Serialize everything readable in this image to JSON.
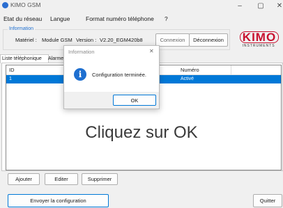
{
  "window": {
    "title": "KIMO GSM",
    "controls": {
      "minimize": "–",
      "maximize": "▢",
      "close": "✕"
    }
  },
  "menu": [
    {
      "label": "Etat du réseau"
    },
    {
      "label": "Langue"
    },
    {
      "label": "Format numéro téléphone"
    },
    {
      "label": "?"
    }
  ],
  "information": {
    "group_title": "Information",
    "materiel_label": "Matériel :",
    "materiel_value": "Module GSM",
    "version_label": "Version :",
    "version_value": "V2.20_EGM420b8",
    "connexion_label": "Connexion",
    "deconnexion_label": "Déconnexion"
  },
  "logo": {
    "name": "KIMO",
    "tagline": "INSTRUMENTS",
    "color": "#c8102e"
  },
  "tabs": [
    {
      "label": "Liste téléphonique",
      "active": true
    },
    {
      "label": "Alarme",
      "active": false
    }
  ],
  "table": {
    "columns": [
      "ID",
      "Numéro"
    ],
    "rows": [
      {
        "id": "1",
        "numero": "Activé",
        "selected": true
      }
    ]
  },
  "list_buttons": {
    "ajouter": "Ajouter",
    "editer": "Editer",
    "supprimer": "Supprimer"
  },
  "footer": {
    "send_config": "Envoyer la configuration",
    "quit": "Quitter"
  },
  "dialog": {
    "title": "Information",
    "close": "✕",
    "message": "Configuration terminée.",
    "icon_glyph": "i",
    "ok_label": "OK"
  },
  "overlay_text": "Cliquez sur OK",
  "colors": {
    "selection": "#0078d7",
    "info_icon": "#1e6fd0",
    "dialog_title_text": "#8a8a8a"
  }
}
